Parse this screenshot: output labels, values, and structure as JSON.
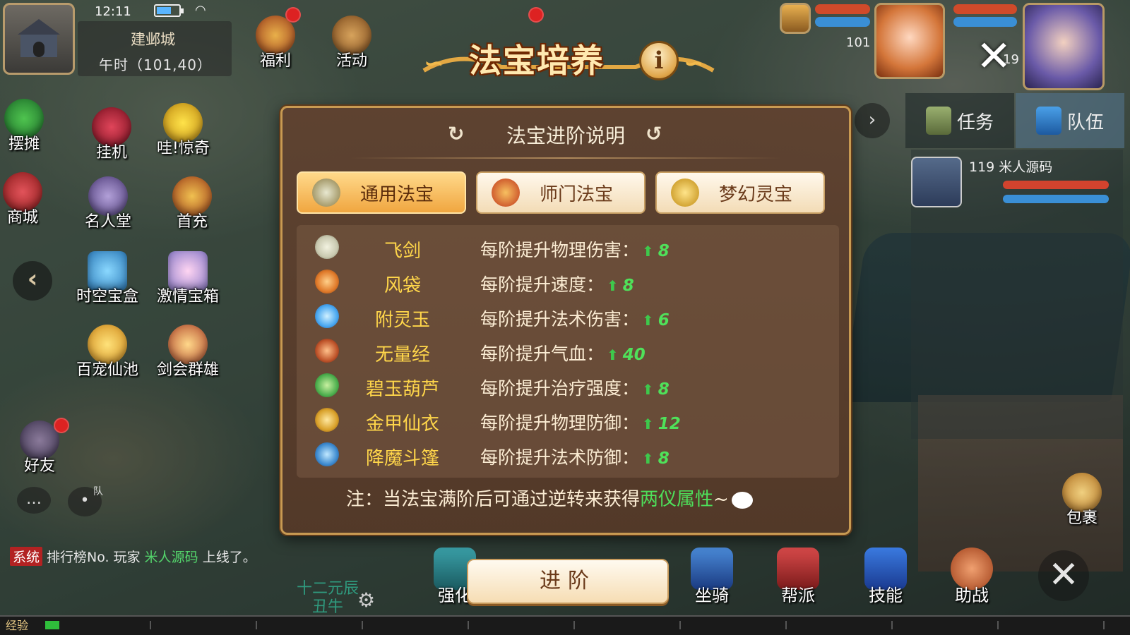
{
  "status_bar": {
    "time": "12:11"
  },
  "location": {
    "city": "建邺城",
    "coords": "午时（101,40）"
  },
  "top_menu": [
    {
      "label": "福利",
      "icon": "gift-chest-icon"
    },
    {
      "label": "活动",
      "icon": "horn-icon"
    }
  ],
  "left_menu": [
    {
      "label": "摆摊",
      "icon": "stall-icon"
    },
    {
      "label": "挂机",
      "icon": "afk-icon"
    },
    {
      "label": "哇!惊奇",
      "icon": "surprise-face-icon"
    },
    {
      "label": "商城",
      "icon": "shop-icon"
    },
    {
      "label": "名人堂",
      "icon": "hall-of-fame-icon"
    },
    {
      "label": "首充",
      "icon": "first-recharge-icon"
    },
    {
      "label": "时空宝盒",
      "icon": "time-box-icon"
    },
    {
      "label": "激情宝箱",
      "icon": "treasure-chest-icon"
    },
    {
      "label": "百宠仙池",
      "icon": "pet-pool-icon"
    },
    {
      "label": "剑会群雄",
      "icon": "sword-arena-icon"
    },
    {
      "label": "好友",
      "icon": "friends-icon"
    }
  ],
  "chat": {
    "mic_tag": "队",
    "system_tag": "系统",
    "message_prefix": "排行榜No.",
    "message_player_label": " 玩家 ",
    "player_name": "米人源码",
    "message_suffix": " 上线了。"
  },
  "zodiac": {
    "line1": "十二元辰",
    "line2": "丑牛"
  },
  "exp_label": "经验",
  "top_right": {
    "level_1": "101",
    "level_2": "19"
  },
  "right_tabs": [
    {
      "label": "任务",
      "icon": "scroll-icon"
    },
    {
      "label": "队伍",
      "icon": "flag-icon"
    }
  ],
  "team": {
    "level_name": "119 米人源码"
  },
  "bottom_menu": [
    {
      "label": "强化",
      "icon": "forge-icon"
    },
    {
      "label": "坐骑",
      "icon": "mount-icon"
    },
    {
      "label": "帮派",
      "icon": "guild-icon"
    },
    {
      "label": "技能",
      "icon": "skill-book-icon"
    },
    {
      "label": "助战",
      "icon": "monkey-helper-icon"
    }
  ],
  "side_labels": {
    "bag": "包裹"
  },
  "modal": {
    "title": "法宝培养",
    "subtitle": "法宝进阶说明",
    "tabs": [
      {
        "label": "通用法宝",
        "active": true,
        "icon": "crossed-swords-icon"
      },
      {
        "label": "师门法宝",
        "active": false,
        "icon": "bell-icon"
      },
      {
        "label": "梦幻灵宝",
        "active": false,
        "icon": "golden-gourd-icon"
      }
    ],
    "items": [
      {
        "name": "飞剑",
        "desc": "每阶提升物理伤害：",
        "value": "8",
        "icon": "flying-sword-icon",
        "color": "#c9c9b0"
      },
      {
        "name": "风袋",
        "desc": "每阶提升速度：",
        "value": "8",
        "icon": "wind-bag-icon",
        "color": "#e07a2a"
      },
      {
        "name": "附灵玉",
        "desc": "每阶提升法术伤害：",
        "value": "6",
        "icon": "spirit-jade-icon",
        "color": "#4aa8f0"
      },
      {
        "name": "无量经",
        "desc": "每阶提升气血：",
        "value": "40",
        "icon": "sutra-icon",
        "color": "#c0552b"
      },
      {
        "name": "碧玉葫芦",
        "desc": "每阶提升治疗强度：",
        "value": "8",
        "icon": "jade-gourd-icon",
        "color": "#4fb04f"
      },
      {
        "name": "金甲仙衣",
        "desc": "每阶提升物理防御：",
        "value": "12",
        "icon": "golden-armor-icon",
        "color": "#d9a12a"
      },
      {
        "name": "降魔斗篷",
        "desc": "每阶提升法术防御：",
        "value": "8",
        "icon": "demon-cloak-icon",
        "color": "#3e8bd0"
      }
    ],
    "note_prefix": "注：当法宝满阶后可通过逆转来获得",
    "note_highlight": "两仪属性",
    "note_suffix": "~",
    "advance_label": "进阶"
  },
  "colors": {
    "accent_gold": "#f0a640",
    "item_name": "#ffd64a",
    "value_green": "#4fe15a",
    "panel_brown": "#5f4230"
  }
}
